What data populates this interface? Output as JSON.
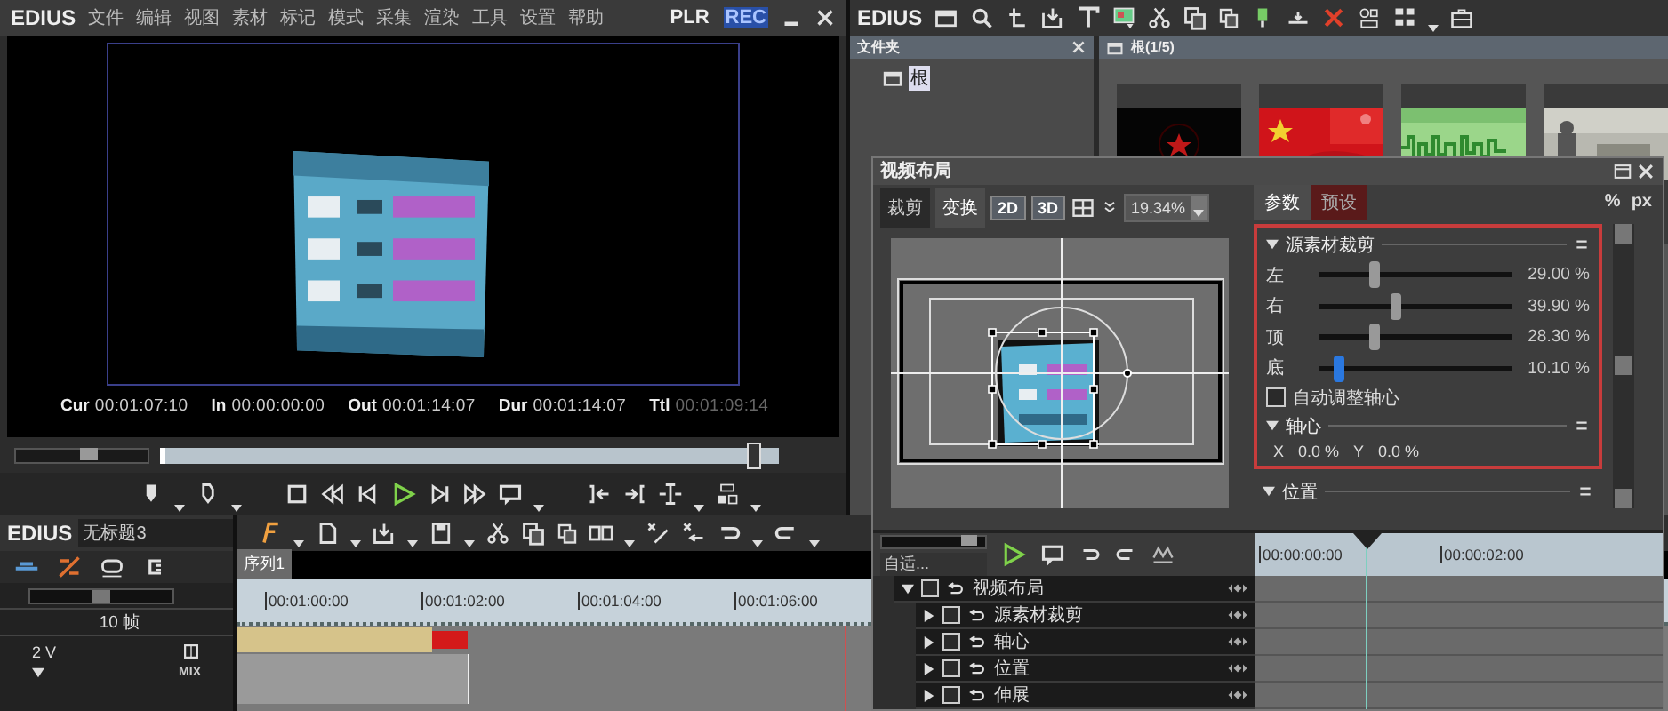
{
  "player": {
    "brand": "EDIUS",
    "menu": [
      "文件",
      "编辑",
      "视图",
      "素材",
      "标记",
      "模式",
      "采集",
      "渲染",
      "工具",
      "设置",
      "帮助"
    ],
    "modes": [
      {
        "label": "PLR",
        "selected": false
      },
      {
        "label": "REC",
        "selected": true
      }
    ],
    "timecodes": [
      {
        "label": "Cur",
        "value": "00:01:07:10",
        "dimmed": false
      },
      {
        "label": "In",
        "value": "00:00:00:00",
        "dimmed": false
      },
      {
        "label": "Out",
        "value": "00:01:14:07",
        "dimmed": false
      },
      {
        "label": "Dur",
        "value": "00:01:14:07",
        "dimmed": false
      },
      {
        "label": "Ttl",
        "value": "00:01:09:14",
        "dimmed": true
      }
    ],
    "jog": {
      "level": 0.55
    },
    "scrubber": {
      "level": 0.96
    }
  },
  "bin": {
    "brand": "EDIUS",
    "folder_panel": {
      "title": "文件夹",
      "items": [
        {
          "label": "根",
          "selected": true
        }
      ]
    },
    "clip_panel": {
      "title": "根(1/5)"
    }
  },
  "dialog": {
    "title": "视频布局",
    "view_tabs": [
      {
        "label": "裁剪",
        "selected": false
      },
      {
        "label": "变换",
        "selected": true
      }
    ],
    "mode_buttons": [
      "2D",
      "3D"
    ],
    "zoom": "19.34%",
    "param_tabs": [
      {
        "label": "参数",
        "selected": true
      },
      {
        "label": "预设",
        "selected": false
      }
    ],
    "units": [
      "%",
      "px"
    ],
    "sections": [
      {
        "title": "源素材裁剪",
        "expanded": true,
        "sliders": [
          {
            "label": "左",
            "level": 0.29,
            "reading": "29.00 %",
            "active": false
          },
          {
            "label": "右",
            "level": 0.399,
            "reading": "39.90 %",
            "active": false
          },
          {
            "label": "顶",
            "level": 0.283,
            "reading": "28.30 %",
            "active": false
          },
          {
            "label": "底",
            "level": 0.101,
            "reading": "10.10 %",
            "active": true
          }
        ],
        "checkbox": {
          "label": "自动调整轴心",
          "checked": false
        }
      },
      {
        "title": "轴心",
        "expanded": true,
        "fields": [
          {
            "label": "X",
            "value": "0.0 %"
          },
          {
            "label": "Y",
            "value": "0.0 %"
          }
        ]
      },
      {
        "title": "位置",
        "expanded": true
      }
    ],
    "keyframes": {
      "fit_label": "自适...",
      "zoom_slider": {
        "level": 0.85
      },
      "ruler": [
        "00:00:00:00",
        "00:00:02:00"
      ],
      "tree": [
        {
          "label": "视频布局",
          "expanded": true,
          "checked": false,
          "children": [
            {
              "label": "源素材裁剪",
              "expanded": false,
              "checked": false
            },
            {
              "label": "轴心",
              "expanded": false,
              "checked": false
            },
            {
              "label": "位置",
              "expanded": false,
              "checked": false
            },
            {
              "label": "伸展",
              "expanded": false,
              "checked": false
            }
          ]
        }
      ]
    }
  },
  "timeline": {
    "brand": "EDIUS",
    "project": "无标题3",
    "zoom_slider": {
      "level": 0.5
    },
    "scale": "10 帧",
    "sequence_tabs": [
      {
        "label": "序列1",
        "selected": true
      }
    ],
    "ruler": [
      "00:01:00:00",
      "00:01:02:00",
      "00:01:04:00",
      "00:01:06:00"
    ],
    "tracks": [
      {
        "name": "2 V",
        "mix": "MIX"
      }
    ]
  }
}
